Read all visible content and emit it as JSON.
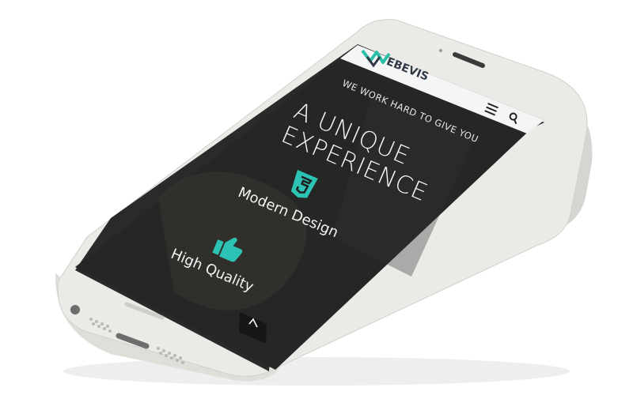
{
  "brand": {
    "logo_text": "EBEVIS"
  },
  "header": {
    "menu_icon": "hamburger-icon",
    "search_icon": "search-icon"
  },
  "hero": {
    "tagline": "WE WORK HARD TO GIVE YOU",
    "headline_line1": "A UNIQUE",
    "headline_line2": "EXPERIENCE"
  },
  "features": [
    {
      "icon": "html5-icon",
      "label": "Modern Design"
    },
    {
      "icon": "thumbs-up-icon",
      "label": "High Quality"
    }
  ],
  "scroll_top": {
    "icon": "chevron-up-icon",
    "glyph": "^"
  },
  "colors": {
    "accent": "#2cc3b5",
    "screen_bg": "#1f1f1f",
    "phone_body": "#e9e8e4",
    "logo_green": "#2bbfa8",
    "logo_dark": "#2f3a46"
  }
}
